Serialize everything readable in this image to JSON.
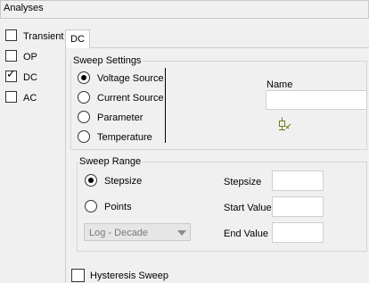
{
  "header": {
    "title": "Analyses"
  },
  "analyses": [
    {
      "label": "Transient",
      "checked": false
    },
    {
      "label": "OP",
      "checked": false
    },
    {
      "label": "DC",
      "checked": true
    },
    {
      "label": "AC",
      "checked": false
    }
  ],
  "tab": {
    "label": "DC"
  },
  "sweep_settings": {
    "title": "Sweep Settings",
    "options": [
      {
        "label": "Voltage Source",
        "selected": true
      },
      {
        "label": "Current Source",
        "selected": false
      },
      {
        "label": "Parameter",
        "selected": false
      },
      {
        "label": "Temperature",
        "selected": false
      }
    ],
    "name_label": "Name",
    "name_value": ""
  },
  "sweep_range": {
    "title": "Sweep Range",
    "modes": [
      {
        "label": "Stepsize",
        "selected": true
      },
      {
        "label": "Points",
        "selected": false
      }
    ],
    "scale_select": "Log - Decade",
    "fields": [
      {
        "label": "Stepsize",
        "value": ""
      },
      {
        "label": "Start Value",
        "value": ""
      },
      {
        "label": "End Value",
        "value": ""
      }
    ]
  },
  "hysteresis": {
    "label": "Hysteresis Sweep",
    "checked": false
  },
  "icons": {
    "component_icon": "voltage-source-picker-icon",
    "check_mark": "check-mark-icon"
  }
}
